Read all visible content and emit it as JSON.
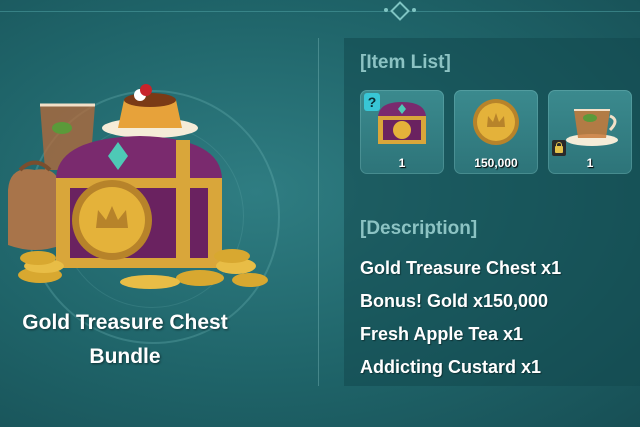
{
  "bundle": {
    "title_line1": "Gold Treasure Chest",
    "title_line2": "Bundle",
    "image_icon": "treasure-chest-bundle-icon"
  },
  "item_list": {
    "heading": "[Item List]",
    "items": [
      {
        "icon": "treasure-chest-icon",
        "quantity": "1",
        "badge": "?"
      },
      {
        "icon": "gold-coin-icon",
        "quantity": "150,000"
      },
      {
        "icon": "apple-tea-icon",
        "quantity": "1",
        "badge_icon": "lock-icon"
      }
    ]
  },
  "description": {
    "heading": "[Description]",
    "lines": [
      "Gold Treasure Chest x1",
      "Bonus! Gold x150,000",
      "Fresh Apple Tea x1",
      "Addicting Custard x1"
    ]
  },
  "colors": {
    "background": "#1f6469",
    "panel": "#12484e",
    "slot": "#3b8a8e",
    "heading": "#8cc3c3",
    "gold": "#e4b23a",
    "chest_purple": "#7a2a6e"
  }
}
